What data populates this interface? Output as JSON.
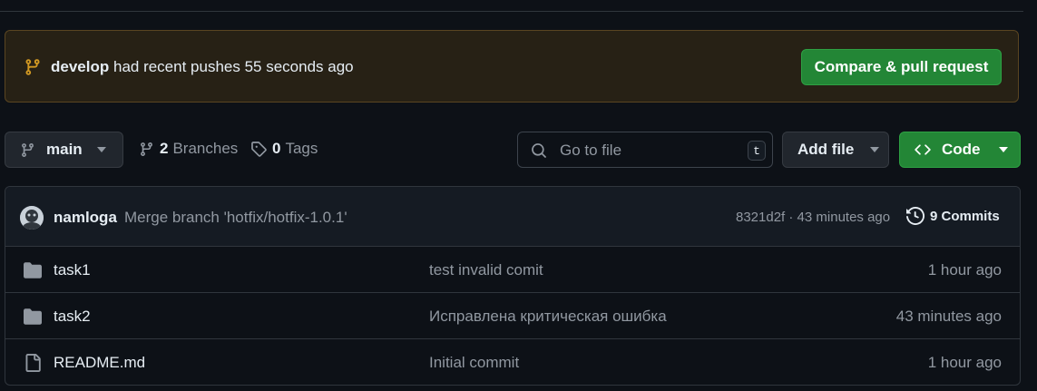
{
  "banner": {
    "branch": "develop",
    "message": "had recent pushes 55 seconds ago",
    "button": "Compare & pull request"
  },
  "toolbar": {
    "branch": "main",
    "branches_count": "2",
    "branches_label": "Branches",
    "tags_count": "0",
    "tags_label": "Tags",
    "search_placeholder": "Go to file",
    "search_shortcut": "t",
    "add_file": "Add file",
    "code": "Code"
  },
  "latest_commit": {
    "author": "namloga",
    "message": "Merge branch 'hotfix/hotfix-1.0.1'",
    "hash_time": "8321d2f · 43 minutes ago",
    "commits_label": "9 Commits"
  },
  "files": [
    {
      "name": "task1",
      "type": "folder",
      "message": "test invalid comit",
      "time": "1 hour ago"
    },
    {
      "name": "task2",
      "type": "folder",
      "message": "Исправлена критическая ошибка",
      "time": "43 minutes ago"
    },
    {
      "name": "README.md",
      "type": "file",
      "message": "Initial commit",
      "time": "1 hour ago"
    }
  ],
  "colors": {
    "background": "#0d1117",
    "green": "#238636",
    "banner": "#272115"
  }
}
